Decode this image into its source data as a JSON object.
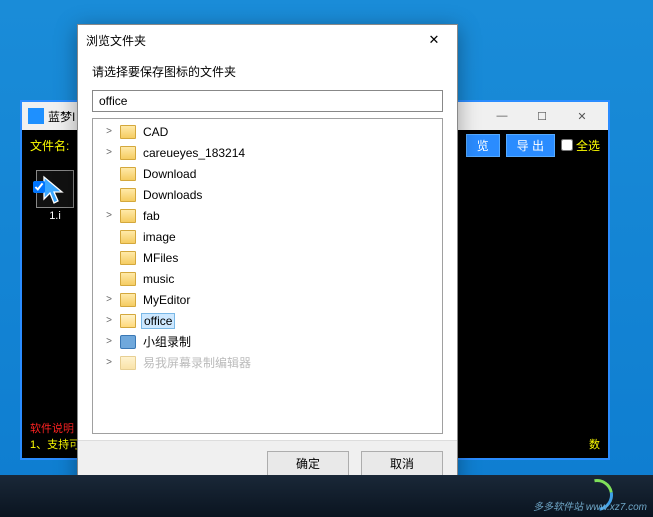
{
  "parent": {
    "title": "蓝梦I",
    "label_filename": "文件名:",
    "btn_browse": "览",
    "btn_export": "导 出",
    "chk_all": "全选",
    "thumb_label": "1.i",
    "footer_l1": "软件说明",
    "footer_l2": "1、支持可",
    "footer_r": "数"
  },
  "dialog": {
    "title": "浏览文件夹",
    "subtitle": "请选择要保存图标的文件夹",
    "input_value": "office",
    "btn_ok": "确定",
    "btn_cancel": "取消",
    "tree": [
      {
        "expand": ">",
        "type": "folder",
        "label": "CAD"
      },
      {
        "expand": ">",
        "type": "folder",
        "label": "careueyes_183214"
      },
      {
        "expand": "",
        "type": "folder",
        "label": "Download"
      },
      {
        "expand": "",
        "type": "folder",
        "label": "Downloads"
      },
      {
        "expand": ">",
        "type": "folder",
        "label": "fab"
      },
      {
        "expand": "",
        "type": "folder",
        "label": "image"
      },
      {
        "expand": "",
        "type": "folder",
        "label": "MFiles"
      },
      {
        "expand": "",
        "type": "folder",
        "label": "music"
      },
      {
        "expand": ">",
        "type": "folder",
        "label": "MyEditor"
      },
      {
        "expand": ">",
        "type": "folder-open",
        "label": "office",
        "selected": true
      },
      {
        "expand": ">",
        "type": "pc",
        "label": "小组录制"
      },
      {
        "expand": ">",
        "type": "folder",
        "label": "易我屏幕录制编辑器",
        "cut": true
      }
    ]
  },
  "watermark": "多多软件站\nwww.xz7.com"
}
